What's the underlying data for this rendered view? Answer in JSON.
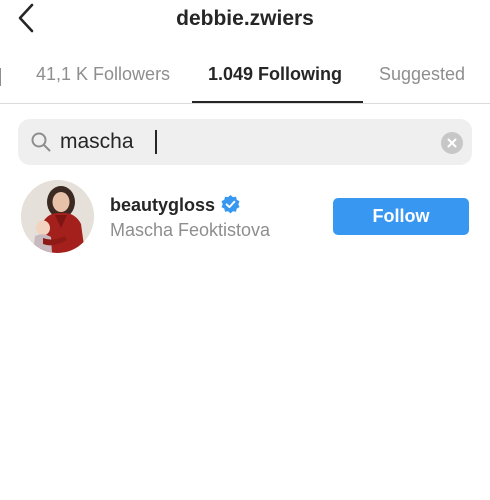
{
  "header": {
    "title": "debbie.zwiers",
    "back_icon": "chevron-left-icon"
  },
  "tabs": [
    {
      "label": "41,1 K Followers",
      "active": false
    },
    {
      "label": "1.049 Following",
      "active": true
    },
    {
      "label": "Suggested",
      "active": false
    }
  ],
  "search": {
    "value": "mascha",
    "placeholder": "Search",
    "icon": "search-icon",
    "clear_icon": "clear-icon"
  },
  "results": [
    {
      "username": "beautygloss",
      "full_name": "Mascha Feoktistova",
      "verified": true,
      "follow_label": "Follow"
    }
  ],
  "colors": {
    "primary_text": "#262626",
    "secondary_text": "#8e8e8e",
    "follow_button": "#3897f0",
    "verified_badge": "#3897f0",
    "search_bg": "#efefef"
  }
}
